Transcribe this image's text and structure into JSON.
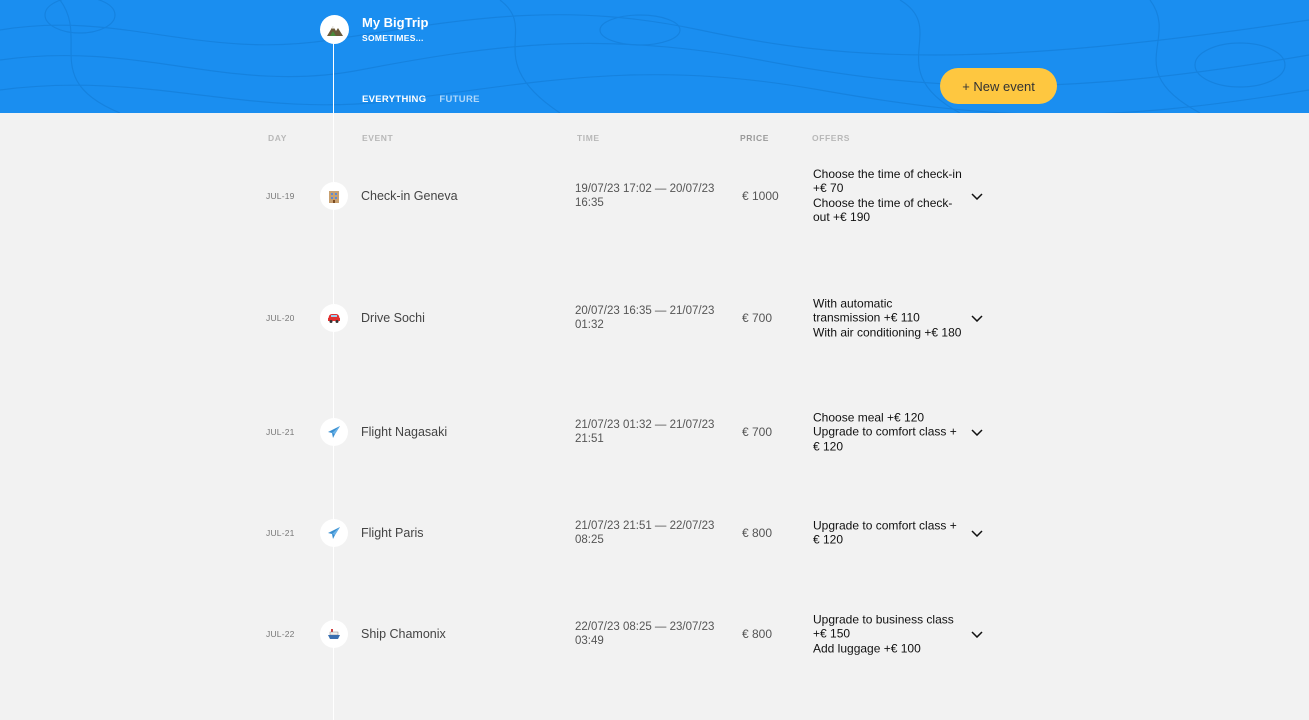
{
  "header": {
    "title": "My BigTrip",
    "subtitle": "SOMETIMES...",
    "filters": [
      "EVERYTHING",
      "FUTURE"
    ],
    "new_event_label": "+ New event",
    "accent": "#1a8ef0",
    "button_color": "#fec740"
  },
  "columns": {
    "day": "DAY",
    "event": "EVENT",
    "time": "TIME",
    "price": "PRICE",
    "offers": "OFFERS"
  },
  "events": [
    {
      "day": "JUL-19",
      "icon": "hotel-icon",
      "name": "Check-in Geneva",
      "time": "19/07/23 17:02 — 20/07/23 16:35",
      "price": "€ 1000",
      "offers": [
        "Choose the time of check-in +€  70",
        "Choose the time of check-out +€  190"
      ]
    },
    {
      "day": "JUL-20",
      "icon": "car-icon",
      "name": "Drive Sochi",
      "time": "20/07/23 16:35 — 21/07/23 01:32",
      "price": "€ 700",
      "offers": [
        "With automatic transmission +€  110",
        "With air conditioning +€  180"
      ]
    },
    {
      "day": "JUL-21",
      "icon": "airplane-icon",
      "name": "Flight Nagasaki",
      "time": "21/07/23 01:32 — 21/07/23 21:51",
      "price": "€ 700",
      "offers": [
        "Choose meal +€  120",
        "Upgrade to comfort class +€  120"
      ]
    },
    {
      "day": "JUL-21",
      "icon": "airplane-icon",
      "name": "Flight Paris",
      "time": "21/07/23 21:51 — 22/07/23 08:25",
      "price": "€ 800",
      "offers": [
        "Upgrade to comfort class +€  120"
      ]
    },
    {
      "day": "JUL-22",
      "icon": "ship-icon",
      "name": "Ship Chamonix",
      "time": "22/07/23 08:25 — 23/07/23 03:49",
      "price": "€ 800",
      "offers": [
        "Upgrade to business class +€  150",
        "Add luggage +€  100"
      ]
    }
  ]
}
